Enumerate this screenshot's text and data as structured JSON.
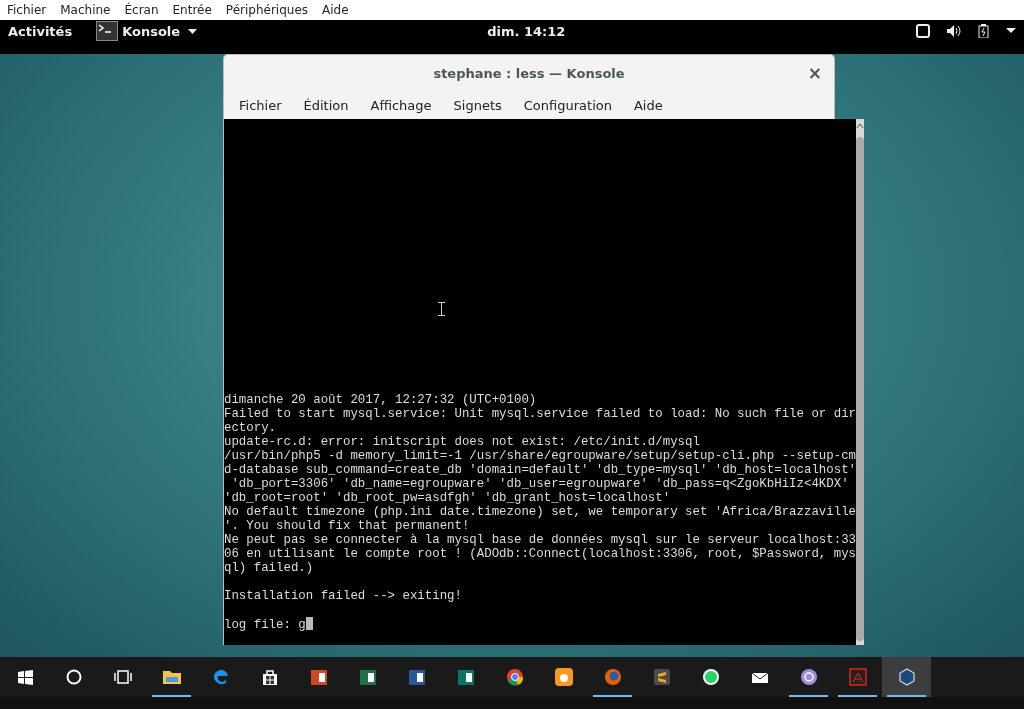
{
  "host_menu": [
    "Fichier",
    "Machine",
    "Écran",
    "Entrée",
    "Périphériques",
    "Aide"
  ],
  "top_bar": {
    "activities": "Activités",
    "app": "Konsole",
    "clock": "dim. 14:12"
  },
  "window": {
    "title": "stephane : less — Konsole",
    "close": "×",
    "menu": [
      "Fichier",
      "Édition",
      "Affichage",
      "Signets",
      "Configuration",
      "Aide"
    ],
    "terminal_lines": [
      {
        "kind": "text",
        "text": "dimanche 20 août 2017, 12:27:32 (UTC+0100)"
      },
      {
        "kind": "text",
        "text": "Failed to start mysql.service: Unit mysql.service failed to load: No such file or dir"
      },
      {
        "kind": "text",
        "text": "ectory."
      },
      {
        "kind": "text",
        "text": "update-rc.d: error: initscript does not exist: /etc/init.d/mysql"
      },
      {
        "kind": "text",
        "text": "/usr/bin/php5 -d memory_limit=-1 /usr/share/egroupware/setup/setup-cli.php --setup-cm"
      },
      {
        "kind": "text",
        "text": "d-database sub_command=create_db 'domain=default' 'db_type=mysql' 'db_host=localhost'"
      },
      {
        "kind": "text",
        "text": " 'db_port=3306' 'db_name=egroupware' 'db_user=egroupware' 'db_pass=q<ZgoKbHiIz<4KDX'"
      },
      {
        "kind": "text",
        "text": "'db_root=root' 'db_root_pw=asdfgh' 'db_grant_host=localhost'"
      },
      {
        "kind": "text",
        "text": "No default timezone (php.ini date.timezone) set, we temporary set 'Africa/Brazzaville"
      },
      {
        "kind": "text",
        "text": "'. You should fix that permanent!"
      },
      {
        "kind": "text",
        "text": "Ne peut pas se connecter à la mysql base de données mysql sur le serveur localhost:33"
      },
      {
        "kind": "text",
        "text": "06 en utilisant le compte root ! (ADOdb::Connect(localhost:3306, root, $Password, mys"
      },
      {
        "kind": "text",
        "text": "ql) failed.)"
      },
      {
        "kind": "blank"
      },
      {
        "kind": "text",
        "text": "Installation failed --> exiting!"
      },
      {
        "kind": "blank"
      },
      {
        "kind": "prompt",
        "text": "log file: g"
      }
    ]
  },
  "taskbar": [
    {
      "kind": "start",
      "running": false,
      "selected": false
    },
    {
      "kind": "search",
      "running": false,
      "selected": false
    },
    {
      "kind": "taskview",
      "running": false,
      "selected": false
    },
    {
      "kind": "folder",
      "running": true,
      "selected": false
    },
    {
      "kind": "edge",
      "running": false,
      "selected": false
    },
    {
      "kind": "store",
      "running": false,
      "selected": false
    },
    {
      "kind": "slides",
      "running": false,
      "selected": false
    },
    {
      "kind": "sheet",
      "running": false,
      "selected": false
    },
    {
      "kind": "doc",
      "running": false,
      "selected": false
    },
    {
      "kind": "publisher",
      "running": false,
      "selected": false
    },
    {
      "kind": "chrome",
      "running": false,
      "selected": false
    },
    {
      "kind": "ucbrowser",
      "running": false,
      "selected": false
    },
    {
      "kind": "firefox",
      "running": true,
      "selected": false
    },
    {
      "kind": "sublime",
      "running": false,
      "selected": false
    },
    {
      "kind": "whatsapp",
      "running": false,
      "selected": false
    },
    {
      "kind": "mail",
      "running": false,
      "selected": false
    },
    {
      "kind": "torrent",
      "running": true,
      "selected": false
    },
    {
      "kind": "pdf",
      "running": true,
      "selected": false
    },
    {
      "kind": "vbox",
      "running": true,
      "selected": true
    }
  ]
}
